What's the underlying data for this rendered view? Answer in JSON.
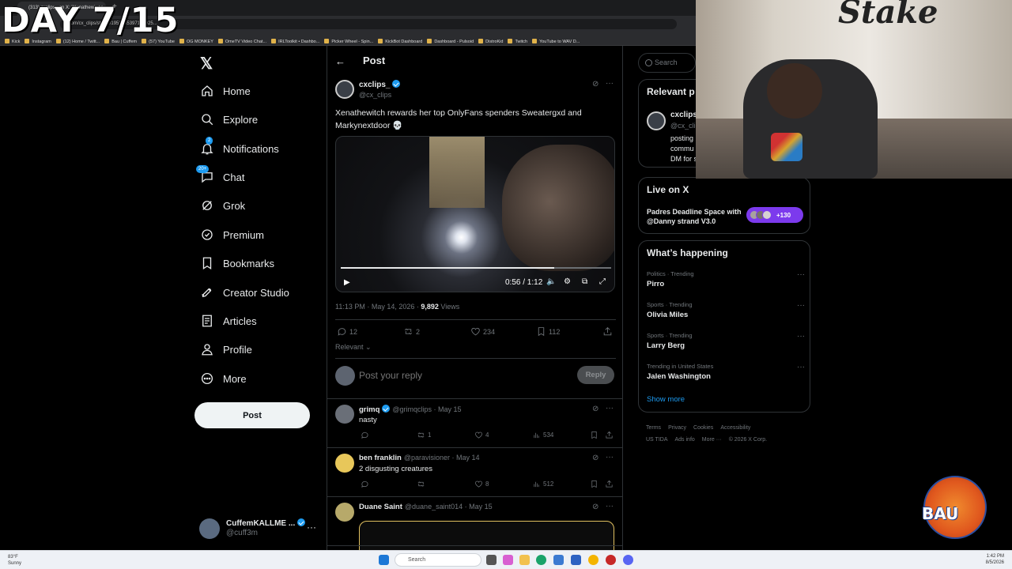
{
  "overlay": {
    "day_counter": "DAY 7/15"
  },
  "browser": {
    "tab_title": "(313) cxclips_ on X: \"Xenathewi",
    "url": "x.com/cx_clips/status/1951055397186025...",
    "bookmarks": [
      "Kick",
      "Instagram",
      "(12) Home / Twitt...",
      "Bau | Cuffem",
      "(57) YouTube",
      "OG MONKEY",
      "OmeTV Video Chat...",
      "IRLToolkit • Dashbo...",
      "Picker Wheel - Spin...",
      "KickBot Dashboard",
      "Dashboard - Pulsoid",
      "DistroKid",
      "Twitch",
      "YouTube to WAV D..."
    ]
  },
  "nav": {
    "items": [
      {
        "label": "Home",
        "icon": "home-icon"
      },
      {
        "label": "Explore",
        "icon": "search-icon"
      },
      {
        "label": "Notifications",
        "icon": "bell-icon",
        "badge": "2"
      },
      {
        "label": "Chat",
        "icon": "chat-icon",
        "badge": "20+"
      },
      {
        "label": "Grok",
        "icon": "grok-icon"
      },
      {
        "label": "Premium",
        "icon": "premium-icon"
      },
      {
        "label": "Bookmarks",
        "icon": "bookmark-icon"
      },
      {
        "label": "Creator Studio",
        "icon": "rocket-icon"
      },
      {
        "label": "Articles",
        "icon": "articles-icon"
      },
      {
        "label": "Profile",
        "icon": "person-icon"
      },
      {
        "label": "More",
        "icon": "more-circle-icon"
      }
    ],
    "post_button": "Post",
    "account": {
      "name": "CuffemKALLME ...",
      "handle": "@cuff3m"
    }
  },
  "post": {
    "header": "Post",
    "author": {
      "name": "cxclips_",
      "handle": "@cx_clips"
    },
    "text": "Xenathewitch rewards her top OnlyFans spenders Sweatergxd and Markynextdoor 💀",
    "video": {
      "time": "0:56 / 1:12",
      "progress": 0.79
    },
    "meta": {
      "time": "11:13 PM · May 14, 2026 · ",
      "views": "9,892",
      "views_label": " Views"
    },
    "stats": {
      "replies": "12",
      "reposts": "2",
      "likes": "234",
      "bookmarks": "112"
    },
    "sort": "Relevant",
    "reply_placeholder": "Post your reply",
    "reply_button": "Reply"
  },
  "replies": [
    {
      "name": "grimq",
      "handle": "@grimqclips · May 15",
      "text": "nasty",
      "replies": "",
      "reposts": "1",
      "likes": "4",
      "views": "534"
    },
    {
      "name": "ben franklin",
      "handle": "@paravisioner · May 14",
      "text": "2 disgusting creatures",
      "replies": "",
      "reposts": "",
      "likes": "8",
      "views": "512"
    },
    {
      "name": "Duane Saint",
      "handle": "@duane_saint014 · May 15",
      "text": ""
    }
  ],
  "right": {
    "search_placeholder": "Search",
    "relevant": {
      "title": "Relevant p",
      "name": "cxclips_",
      "handle": "@cx_clip",
      "bio1": "posting",
      "bio2": "commu",
      "bio3": "DM for s"
    },
    "live": {
      "title": "Live on X",
      "text": "Padres Deadline Space with @Danny strand V3.0",
      "count": "+130"
    },
    "happening": {
      "title": "What’s happening",
      "trends": [
        {
          "category": "Politics · Trending",
          "name": "Pirro"
        },
        {
          "category": "Sports · Trending",
          "name": "Olivia Miles"
        },
        {
          "category": "Sports · Trending",
          "name": "Larry Berg"
        },
        {
          "category": "Trending in United States",
          "name": "Jalen Washington"
        }
      ],
      "show_more": "Show more"
    },
    "footer": [
      "Terms",
      "Privacy",
      "Cookies",
      "Accessibility",
      "US TIDA",
      "Ads info",
      "More ···",
      "© 2026 X Corp."
    ]
  },
  "webcam": {
    "sign": "Stake",
    "logo": "BAU"
  },
  "taskbar": {
    "weather_temp": "83°F",
    "weather_desc": "Sunny",
    "search": "Search",
    "time": "1:42 PM",
    "date": "8/5/2026"
  }
}
